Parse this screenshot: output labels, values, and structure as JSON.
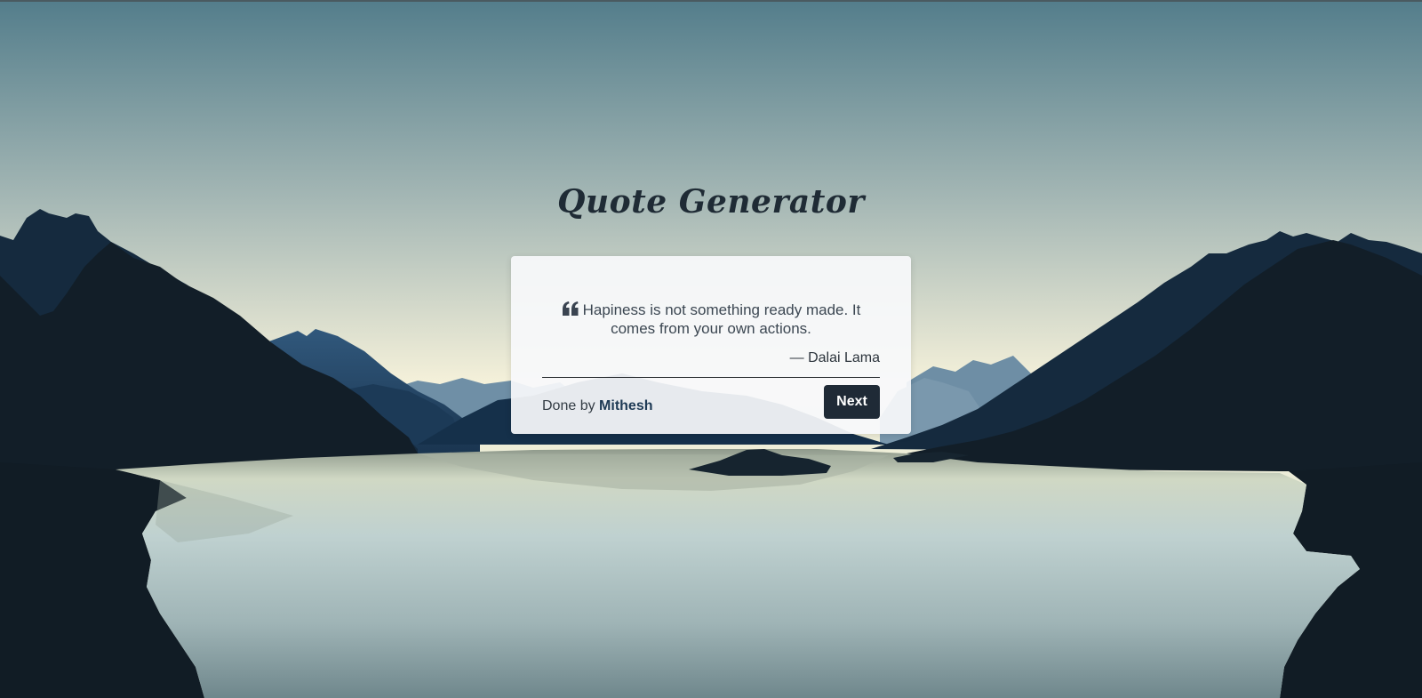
{
  "app": {
    "title": "Quote Generator"
  },
  "quote": {
    "icon": "quote-left-icon",
    "text": "Hapiness is not something ready made. It comes from your own actions.",
    "author": "— Dalai Lama"
  },
  "footer": {
    "credit_prefix": "Done by",
    "credit_name": "Mithesh",
    "next_label": "Next"
  },
  "colors": {
    "sky_top": "#557e8c",
    "sky_horizon": "#f4f1da",
    "mountain_dark": "#121e28",
    "mountain_blue": "#233f5c",
    "button_bg": "#1f2a36"
  }
}
